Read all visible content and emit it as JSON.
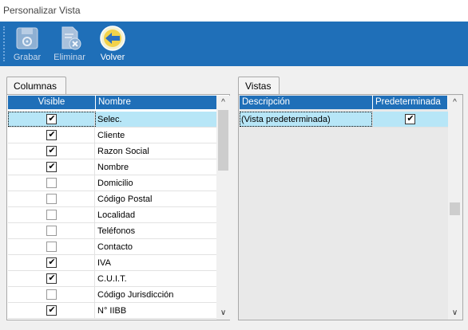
{
  "window": {
    "title": "Personalizar Vista"
  },
  "toolbar": {
    "grabar": "Grabar",
    "eliminar": "Eliminar",
    "volver": "Volver"
  },
  "columnas": {
    "tab_label": "Columnas",
    "headers": {
      "visible": "Visible",
      "nombre": "Nombre"
    },
    "rows": [
      {
        "nombre": "Selec.",
        "visible": true
      },
      {
        "nombre": "Cliente",
        "visible": true
      },
      {
        "nombre": "Razon Social",
        "visible": true
      },
      {
        "nombre": "Nombre",
        "visible": true
      },
      {
        "nombre": "Domicilio",
        "visible": false
      },
      {
        "nombre": "Código Postal",
        "visible": false
      },
      {
        "nombre": "Localidad",
        "visible": false
      },
      {
        "nombre": "Teléfonos",
        "visible": false
      },
      {
        "nombre": "Contacto",
        "visible": false
      },
      {
        "nombre": "IVA",
        "visible": true
      },
      {
        "nombre": "C.U.I.T.",
        "visible": true
      },
      {
        "nombre": "Código Jurisdicción",
        "visible": false
      },
      {
        "nombre": "N° IIBB",
        "visible": true
      }
    ]
  },
  "vistas": {
    "tab_label": "Vistas",
    "headers": {
      "descripcion": "Descripción",
      "predeterminada": "Predeterminada"
    },
    "rows": [
      {
        "descripcion": "(Vista predeterminada)",
        "predeterminada": true
      }
    ]
  },
  "colors": {
    "accent": "#1f6fb8",
    "selection": "#b7e6f7"
  }
}
